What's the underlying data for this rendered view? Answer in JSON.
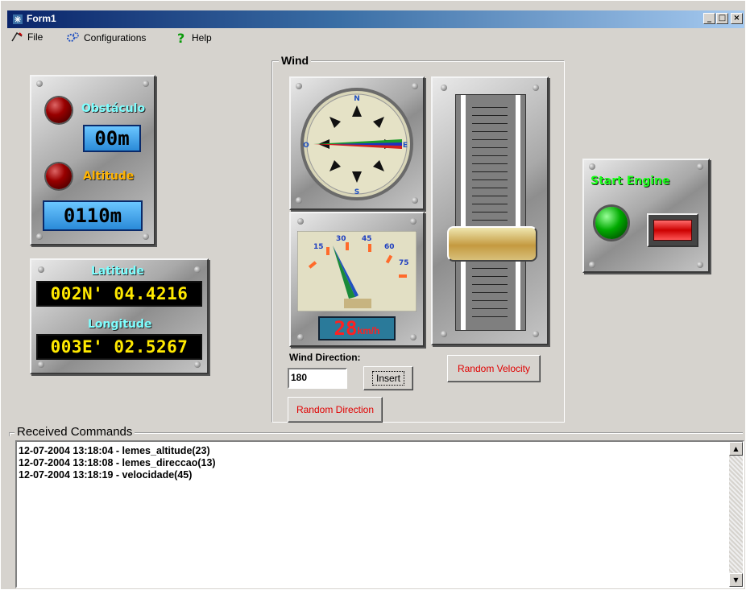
{
  "window": {
    "title": "Form1",
    "minimize": "_",
    "maximize": "□",
    "close": "×"
  },
  "menu": {
    "file": "File",
    "configurations": "Configurations",
    "help": "Help"
  },
  "status_panel": {
    "obstacle_label": "Obstáculo",
    "obstacle_value": "00m",
    "altitude_label": "Altitude",
    "altitude_value": "0110m"
  },
  "gps_panel": {
    "latitude_label": "Latitude",
    "latitude_value": "002N' 04.4216",
    "longitude_label": "Longitude",
    "longitude_value": "003E' 02.5267"
  },
  "wind": {
    "group_title": "Wind",
    "compass_marks": {
      "north": "N",
      "south": "S",
      "east": "E",
      "west": "O"
    },
    "speed_scale": [
      "15",
      "30",
      "45",
      "60",
      "75"
    ],
    "speed_value": "28",
    "speed_unit": "km/h",
    "direction_label": "Wind Direction:",
    "direction_value": "180",
    "insert_button": "Insert",
    "random_direction_button": "Random Direction",
    "random_velocity_button": "Random Velocity",
    "slider_level": 0.35
  },
  "engine": {
    "label": "Start Engine"
  },
  "received_commands": {
    "title": "Received Commands",
    "lines": [
      "12-07-2004 13:18:04 - lemes_altitude(23)",
      "12-07-2004 13:18:08 - lemes_direccao(13)",
      "12-07-2004 13:18:19 - velocidade(45)"
    ]
  },
  "colors": {
    "led_red": "#990000",
    "led_green": "#00aa00",
    "display_yellow": "#ffe900",
    "display_red": "#ff2020",
    "label_cyan": "#7fffff",
    "label_orange": "#ffb300",
    "label_green": "#1aff1a"
  }
}
